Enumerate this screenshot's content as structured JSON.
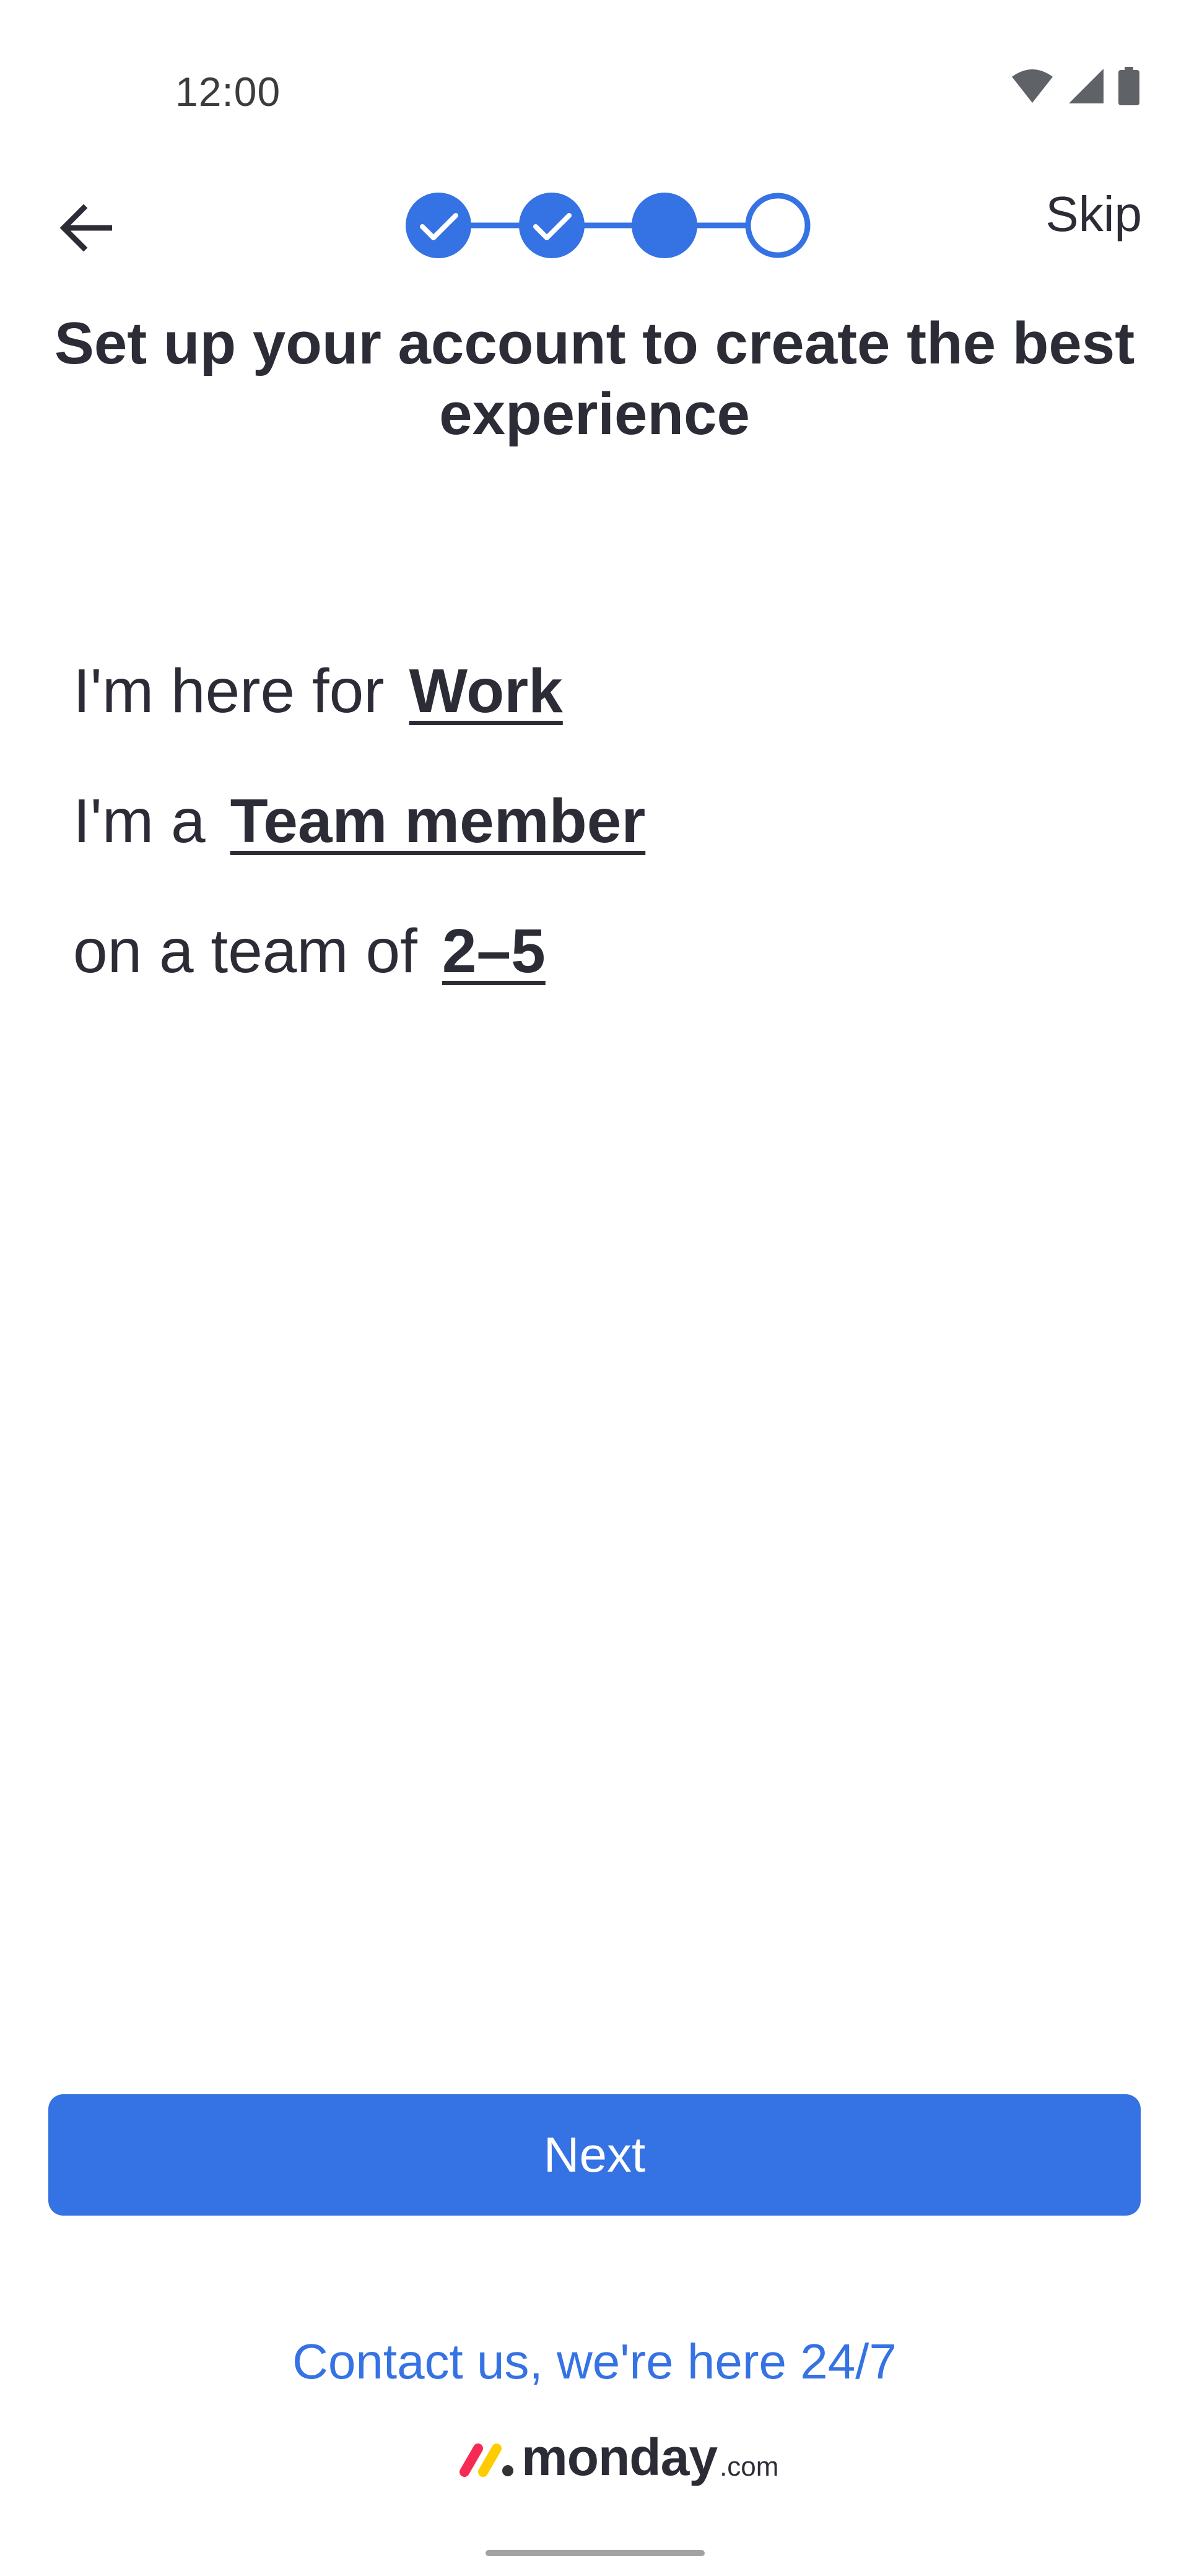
{
  "status_bar": {
    "time": "12:00",
    "icons": [
      "wifi-icon",
      "cellular-signal-icon",
      "battery-icon"
    ]
  },
  "nav": {
    "back_icon": "arrow-left-icon",
    "skip_label": "Skip"
  },
  "stepper": {
    "steps": [
      {
        "state": "completed",
        "icon": "check-icon"
      },
      {
        "state": "completed",
        "icon": "check-icon"
      },
      {
        "state": "current"
      },
      {
        "state": "upcoming"
      }
    ],
    "color": "#3572e3"
  },
  "title": "Set up your account to create the best experience",
  "answers": [
    {
      "prefix": "I'm here for",
      "choice": "Work"
    },
    {
      "prefix": "I'm a",
      "choice": "Team member"
    },
    {
      "prefix": "on a team of",
      "choice": "2–5"
    }
  ],
  "next_label": "Next",
  "contact_label": "Contact us, we're here 24/7",
  "logo": {
    "word": "monday",
    "suffix": ".com",
    "mark_colors": [
      "#f62b54",
      "#ffcc00",
      "#333333"
    ]
  },
  "colors": {
    "accent": "#3572e3",
    "text": "#2b2c36"
  }
}
